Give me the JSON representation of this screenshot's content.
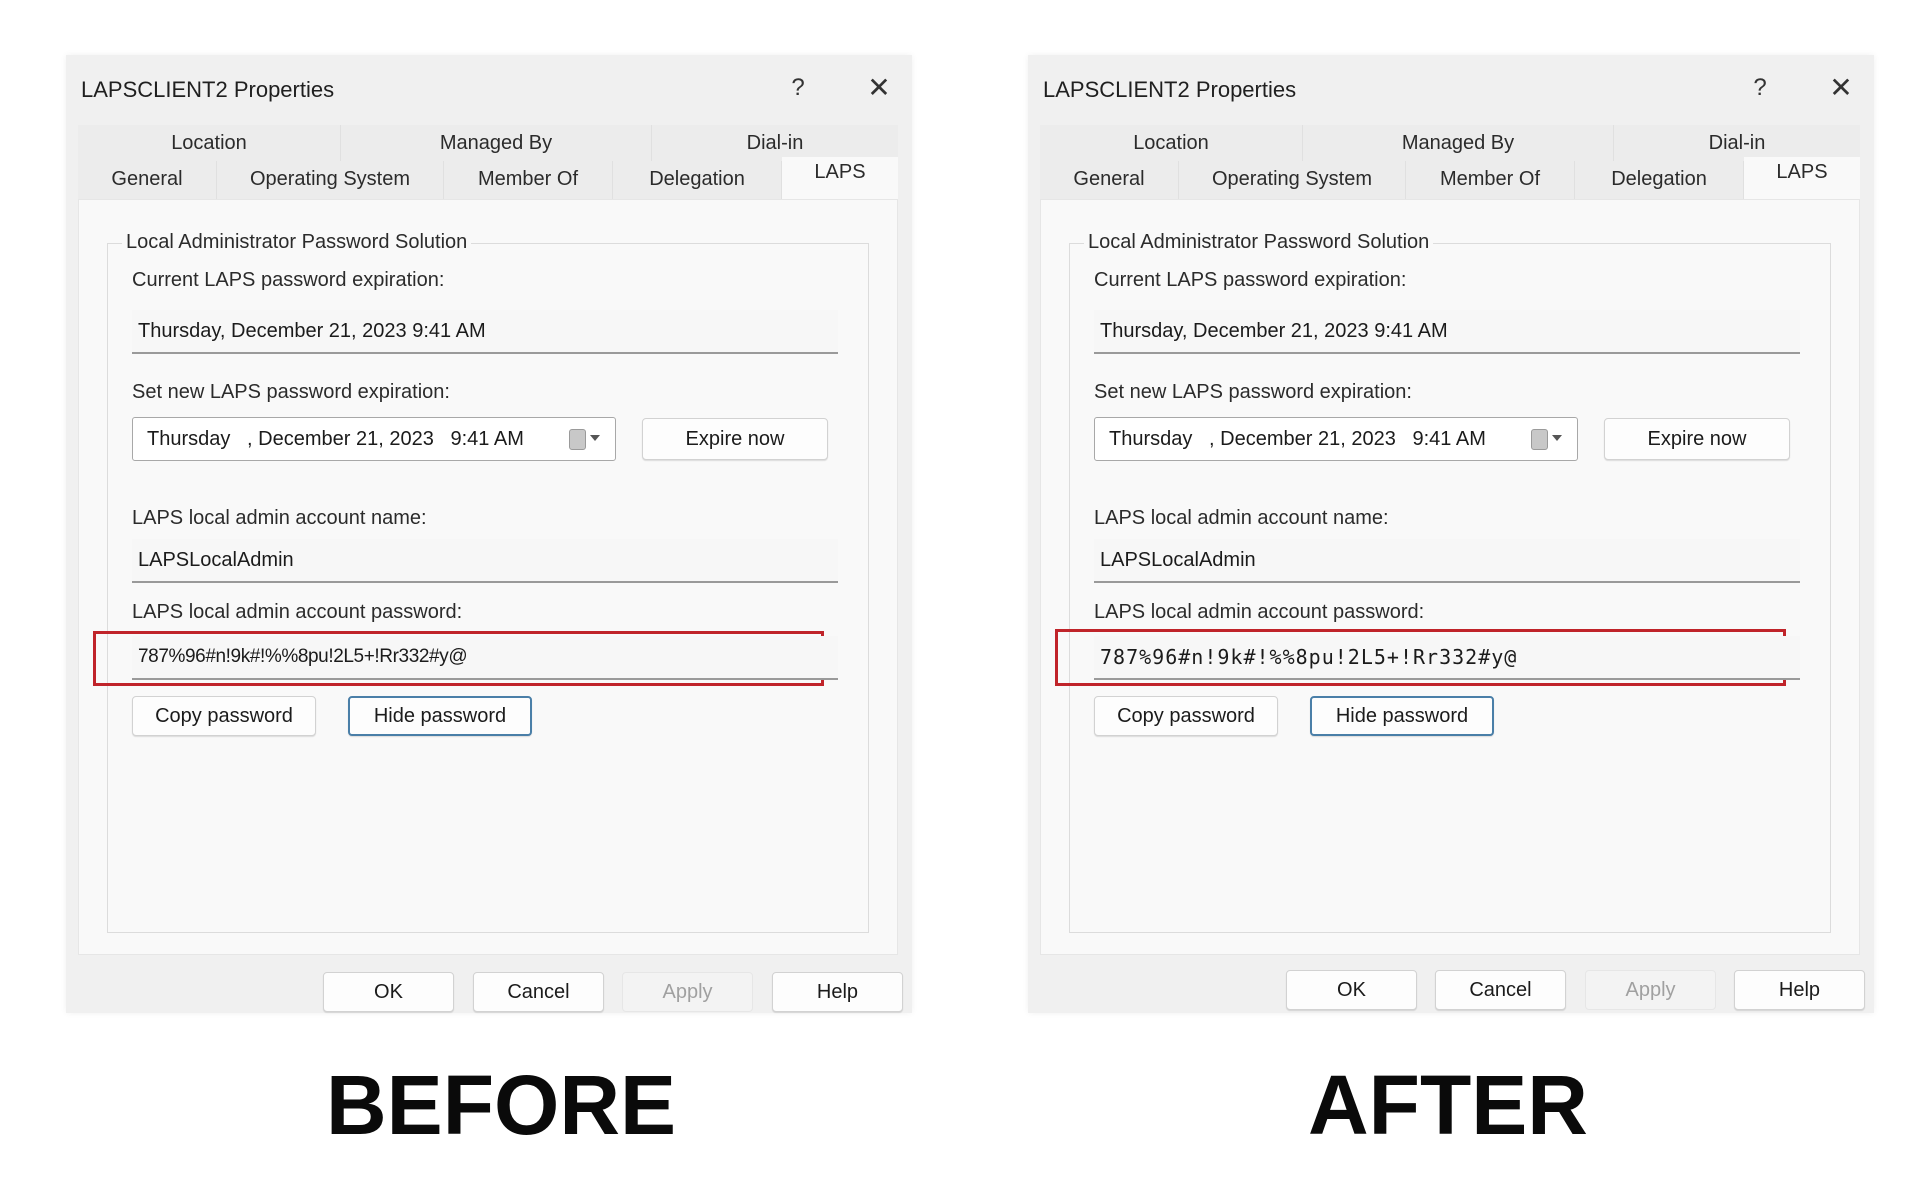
{
  "dialogs": {
    "before": {
      "title": "LAPSCLIENT2 Properties",
      "help_label": "?",
      "close_label": "✕",
      "tabs_row1": [
        "Location",
        "Managed By",
        "Dial-in"
      ],
      "tabs_row2": [
        "General",
        "Operating System",
        "Member Of",
        "Delegation",
        "LAPS"
      ],
      "active_tab": "LAPS",
      "group_label": "Local Administrator Password Solution",
      "current_expiration_label": "Current LAPS password expiration:",
      "current_expiration_value": "Thursday, December 21, 2023 9:41 AM",
      "new_expiration_label": "Set new LAPS password expiration:",
      "new_expiration_value": "Thursday   , December 21, 2023   9:41 AM",
      "expire_now_label": "Expire now",
      "account_name_label": "LAPS local admin account name:",
      "account_name_value": "LAPSLocalAdmin",
      "password_label": "LAPS local admin account password:",
      "password_value": "787%96#n!9k#!%%8pu!2L5+!Rr332#y@",
      "password_font": "proportional",
      "copy_password_label": "Copy password",
      "hide_password_label": "Hide password",
      "ok_label": "OK",
      "cancel_label": "Cancel",
      "apply_label": "Apply",
      "help_button_label": "Help"
    },
    "after": {
      "title": "LAPSCLIENT2 Properties",
      "help_label": "?",
      "close_label": "✕",
      "tabs_row1": [
        "Location",
        "Managed By",
        "Dial-in"
      ],
      "tabs_row2": [
        "General",
        "Operating System",
        "Member Of",
        "Delegation",
        "LAPS"
      ],
      "active_tab": "LAPS",
      "group_label": "Local Administrator Password Solution",
      "current_expiration_label": "Current LAPS password expiration:",
      "current_expiration_value": "Thursday, December 21, 2023 9:41 AM",
      "new_expiration_label": "Set new LAPS password expiration:",
      "new_expiration_value": "Thursday   , December 21, 2023   9:41 AM",
      "expire_now_label": "Expire now",
      "account_name_label": "LAPS local admin account name:",
      "account_name_value": "LAPSLocalAdmin",
      "password_label": "LAPS local admin account password:",
      "password_value": "787%96#n!9k#!%%8pu!2L5+!Rr332#y@",
      "password_font": "monospace",
      "copy_password_label": "Copy password",
      "hide_password_label": "Hide password",
      "ok_label": "OK",
      "cancel_label": "Cancel",
      "apply_label": "Apply",
      "help_button_label": "Help"
    }
  },
  "captions": {
    "before": "BEFORE",
    "after": "AFTER"
  },
  "colors": {
    "highlight_border": "#c0242a",
    "focused_button_border": "#4a7fa8",
    "dialog_background": "#f0f0f0"
  }
}
